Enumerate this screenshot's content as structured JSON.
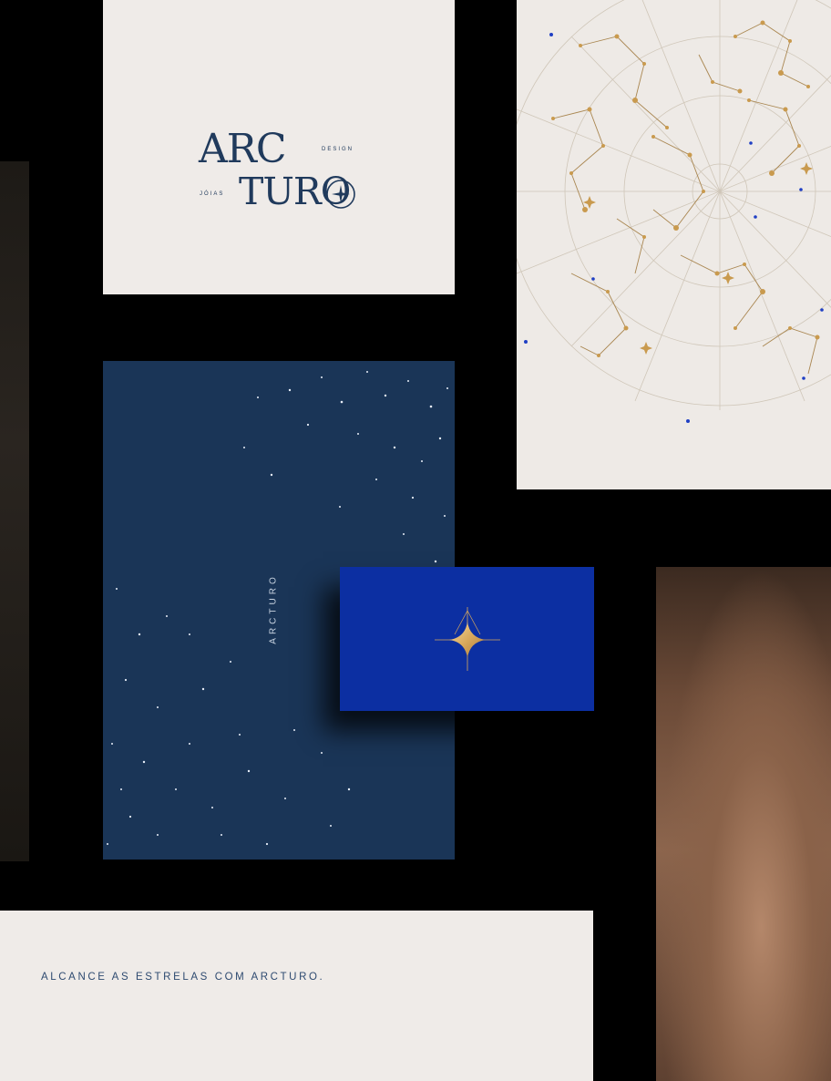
{
  "logo": {
    "line1": "ARC",
    "line2": "TURO",
    "tag_design": "DESIGN",
    "tag_joias": "JÓIAS"
  },
  "navy_card": {
    "brand": "ARCTURO"
  },
  "tagline": {
    "text": "ALCANCE AS ESTRELAS COM ARCTURO."
  },
  "icons": {
    "star_mark": "four-point-star-icon",
    "logo_star": "star-circle-icon"
  },
  "colors": {
    "navy": "#1a3557",
    "royal_blue": "#0c2fa2",
    "paper": "#efebe8",
    "ink": "#203a5c",
    "gold": "#d9a95c"
  }
}
